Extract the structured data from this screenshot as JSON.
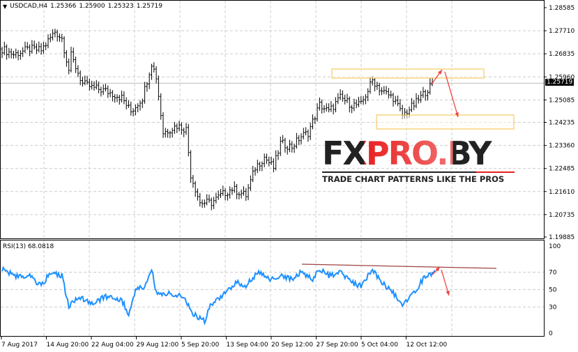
{
  "header": {
    "symbol": "USDCAD,H4",
    "open": "1.25366",
    "high": "1.25900",
    "low": "1.25323",
    "close": "1.25719"
  },
  "rsi_header": "RSI(13) 68.0818",
  "logo": {
    "text": "FXPRO.BY",
    "tagline": "TRADE CHART PATTERNS LIKE THE PROS"
  },
  "current_price_label": "1.25719",
  "colors": {
    "candle": "#000000",
    "rsi": "#1e90ff",
    "arrow": "#f04040",
    "box": "#f5c242",
    "trend": "#a04040"
  },
  "chart_data": [
    {
      "type": "line",
      "title": "USDCAD,H4",
      "ylim": [
        1.19885,
        1.28585
      ],
      "yticks": [
        "1.28585",
        "1.27710",
        "1.26835",
        "1.25960",
        "1.25085",
        "1.24235",
        "1.23360",
        "1.22485",
        "1.21610",
        "1.20735",
        "1.19885"
      ],
      "xticks": [
        "7 Aug 2017",
        "14 Aug 20:00",
        "22 Aug 04:00",
        "29 Aug 12:00",
        "5 Sep 20:00",
        "13 Sep 04:00",
        "20 Sep 12:00",
        "27 Sep 20:00",
        "5 Oct 04:00",
        "12 Oct 12:00"
      ],
      "close_points": [
        [
          0,
          1.2702
        ],
        [
          5,
          1.2681
        ],
        [
          12,
          1.2702
        ],
        [
          17,
          1.2697
        ],
        [
          23,
          1.2768
        ],
        [
          26,
          1.2742
        ],
        [
          29,
          1.2623
        ],
        [
          30,
          1.2676
        ],
        [
          35,
          1.257
        ],
        [
          39,
          1.2556
        ],
        [
          45,
          1.2543
        ],
        [
          52,
          1.2517
        ],
        [
          56,
          1.2464
        ],
        [
          61,
          1.2517
        ],
        [
          65,
          1.2649
        ],
        [
          67,
          1.2596
        ],
        [
          70,
          1.2384
        ],
        [
          76,
          1.2411
        ],
        [
          80,
          1.2397
        ],
        [
          82,
          1.2225
        ],
        [
          86,
          1.2119
        ],
        [
          91,
          1.2119
        ],
        [
          95,
          1.2146
        ],
        [
          100,
          1.2172
        ],
        [
          106,
          1.2146
        ],
        [
          110,
          1.2252
        ],
        [
          114,
          1.2291
        ],
        [
          118,
          1.2252
        ],
        [
          121,
          1.2344
        ],
        [
          126,
          1.2331
        ],
        [
          130,
          1.2371
        ],
        [
          133,
          1.2384
        ],
        [
          138,
          1.249
        ],
        [
          142,
          1.2464
        ],
        [
          147,
          1.2517
        ],
        [
          152,
          1.249
        ],
        [
          156,
          1.249
        ],
        [
          161,
          1.2583
        ],
        [
          165,
          1.2543
        ],
        [
          170,
          1.2517
        ],
        [
          174,
          1.245
        ],
        [
          179,
          1.249
        ],
        [
          183,
          1.253
        ],
        [
          187,
          1.257
        ]
      ],
      "bars_capacity": 236,
      "current_price": 1.25719
    },
    {
      "type": "line",
      "title": "RSI(13) 68.0818",
      "ylim": [
        0,
        100
      ],
      "yticks": [
        "100",
        "70",
        "50",
        "30",
        "0"
      ],
      "points": [
        [
          0,
          74
        ],
        [
          5,
          66
        ],
        [
          12,
          66
        ],
        [
          17,
          54
        ],
        [
          21,
          70
        ],
        [
          26,
          66
        ],
        [
          29,
          30
        ],
        [
          33,
          42
        ],
        [
          39,
          34
        ],
        [
          45,
          42
        ],
        [
          52,
          38
        ],
        [
          55,
          22
        ],
        [
          58,
          50
        ],
        [
          62,
          54
        ],
        [
          65,
          74
        ],
        [
          67,
          46
        ],
        [
          73,
          46
        ],
        [
          79,
          42
        ],
        [
          83,
          22
        ],
        [
          88,
          14
        ],
        [
          91,
          34
        ],
        [
          97,
          46
        ],
        [
          102,
          58
        ],
        [
          106,
          54
        ],
        [
          111,
          70
        ],
        [
          117,
          62
        ],
        [
          121,
          66
        ],
        [
          126,
          62
        ],
        [
          130,
          70
        ],
        [
          135,
          62
        ],
        [
          138,
          74
        ],
        [
          142,
          66
        ],
        [
          147,
          70
        ],
        [
          152,
          58
        ],
        [
          156,
          54
        ],
        [
          161,
          74
        ],
        [
          165,
          58
        ],
        [
          170,
          46
        ],
        [
          174,
          34
        ],
        [
          179,
          46
        ],
        [
          183,
          62
        ],
        [
          188,
          70
        ]
      ]
    }
  ]
}
